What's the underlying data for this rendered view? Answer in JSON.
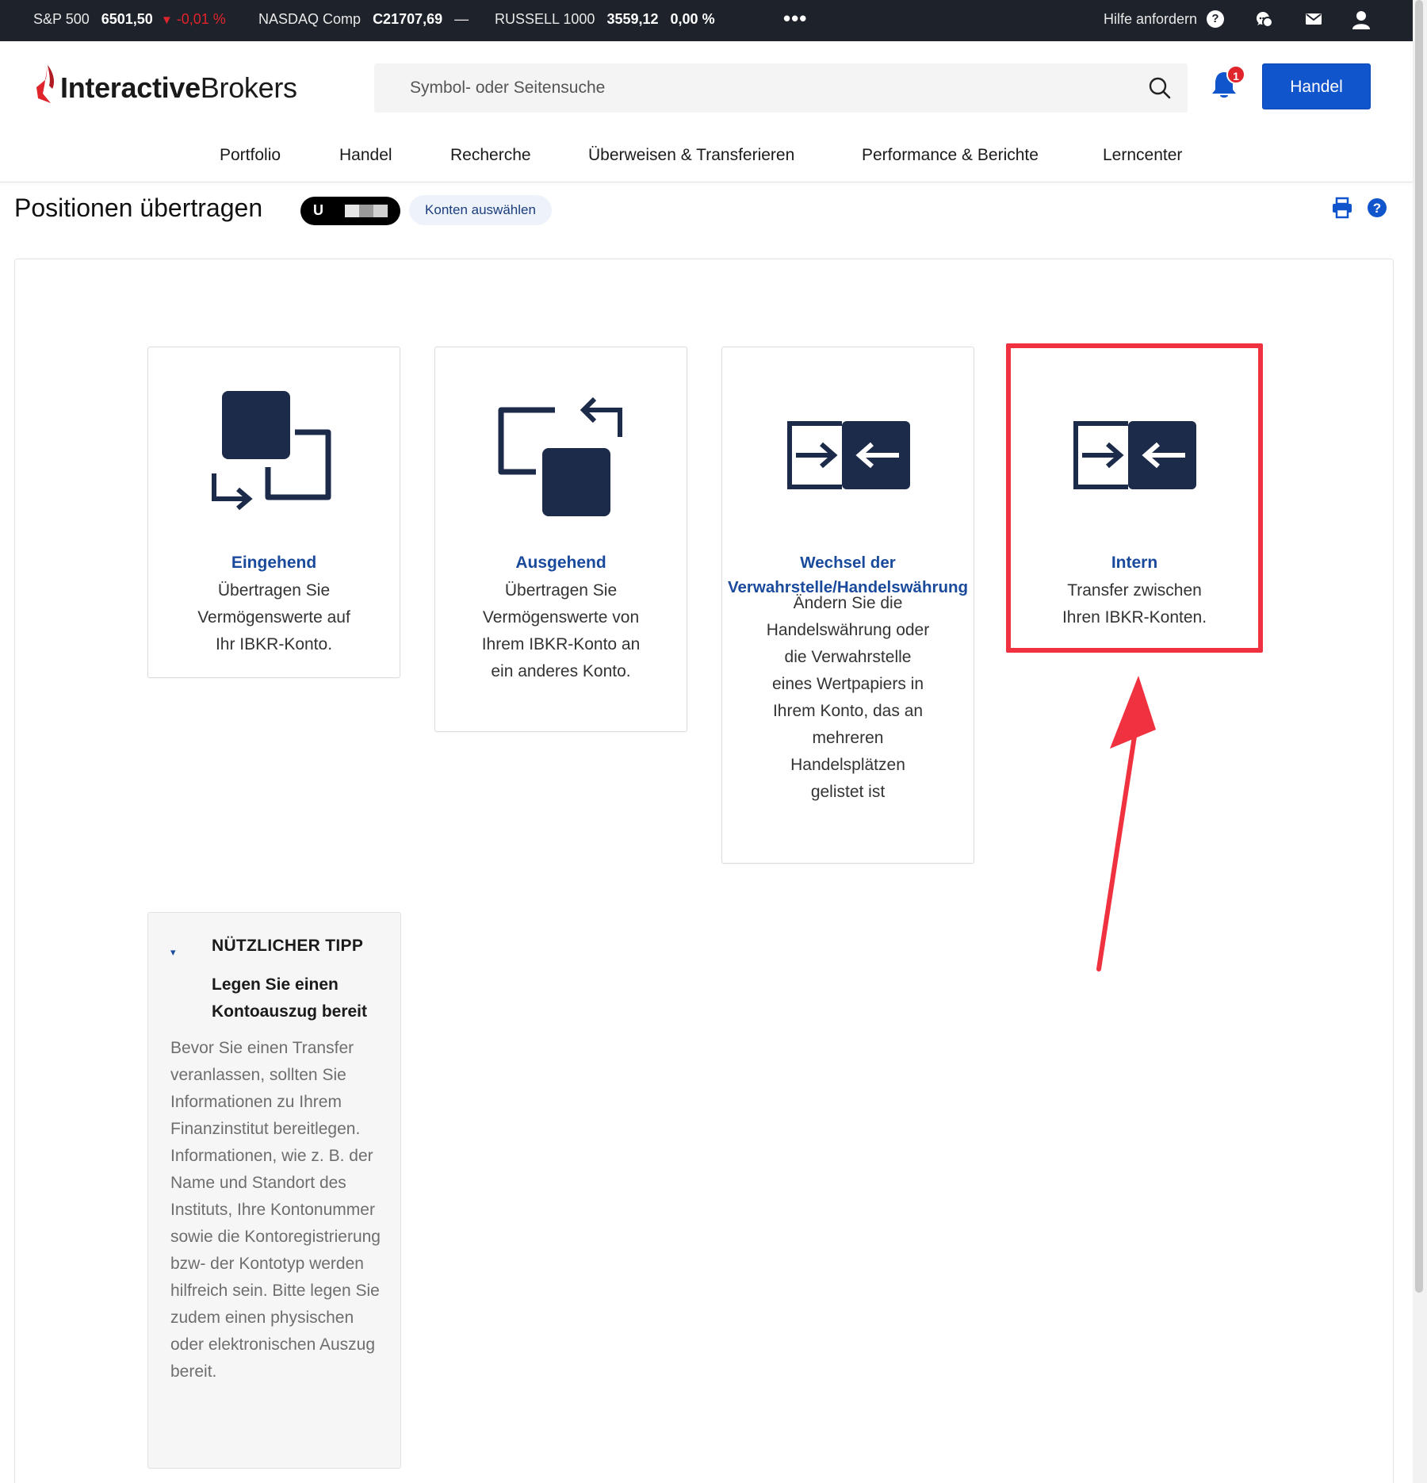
{
  "ticker": {
    "sp500_label": "S&P 500",
    "sp500_value": "6501,50",
    "sp500_change": "-0,01 %",
    "nasdaq_label": "NASDAQ Comp",
    "nasdaq_value": "C21707,69",
    "nasdaq_change": "—",
    "russell_label": "RUSSELL 1000",
    "russell_value": "3559,12",
    "russell_change": "0,00 %",
    "more": "•••",
    "help_label": "Hilfe anfordern",
    "help_q": "?"
  },
  "header": {
    "logo_bold": "Interactive",
    "logo_light": "Brokers",
    "search_placeholder": "Symbol- oder Seitensuche",
    "notification_count": "1",
    "trade_button": "Handel",
    "brand_color": "#1155cc"
  },
  "nav": [
    "Portfolio",
    "Handel",
    "Recherche",
    "Überweisen & Transferieren",
    "Performance & Berichte",
    "Lerncenter"
  ],
  "page": {
    "title": "Positionen übertragen",
    "account_prefix": "U",
    "select_accounts": "Konten auswählen"
  },
  "cards": [
    {
      "icon": "incoming-transfer-icon",
      "title": "Eingehend",
      "desc": "Übertragen Sie Vermögenswerte auf Ihr IBKR-Konto."
    },
    {
      "icon": "outgoing-transfer-icon",
      "title": "Ausgehend",
      "desc": "Übertragen Sie Vermögenswerte von Ihrem IBKR-Konto an ein anderes Konto."
    },
    {
      "icon": "exchange-arrows-icon",
      "title": "Wechsel der Verwahrstelle/Handelswährung",
      "desc": "Ändern Sie die Handelswährung oder die Verwahrstelle eines Wertpapiers in Ihrem Konto, das an mehreren Handelsplätzen gelistet ist"
    },
    {
      "icon": "exchange-arrows-icon",
      "title": "Intern",
      "desc": "Transfer zwischen Ihren IBKR-Konten."
    }
  ],
  "tip": {
    "title": "NÜTZLICHER TIPP",
    "heading": "Legen Sie einen Kontoauszug bereit",
    "body": "Bevor Sie einen Transfer veranlassen, sollten Sie Informationen zu Ihrem Finanzinstitut bereitlegen. Informationen, wie z. B. der Name und Standort des Instituts, Ihre Kontonummer sowie die Kontoregistrierung bzw- der Kontotyp werden hilfreich sein. Bitte legen Sie zudem einen physischen oder elektronischen Auszug bereit."
  },
  "colors": {
    "ticker_bg": "#1e222a",
    "negative": "#e0242c",
    "link_blue": "#1a4a9c",
    "icon_navy": "#1c2b4a",
    "highlight_red": "#f0313f"
  }
}
